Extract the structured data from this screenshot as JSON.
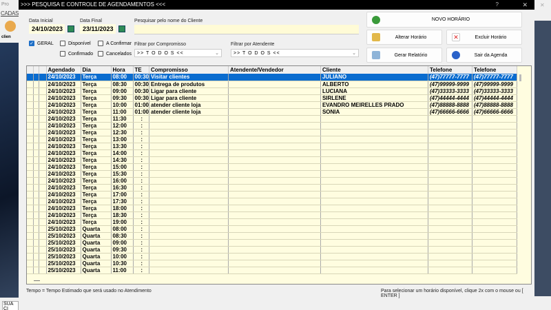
{
  "background_app": {
    "title": "Pro",
    "menu": "CADAS",
    "icon_label": "clien",
    "status": "SUA CI"
  },
  "dialog": {
    "title": ">>>  PESQUISA E CONTROLE DE AGENDAMENTOS  <<<",
    "help": "?",
    "close": "✕"
  },
  "filters": {
    "data_inicial_label": "Data Inicial",
    "data_inicial": "24/10/2023",
    "data_final_label": "Data Final",
    "data_final": "23/11/2023",
    "search_label": "Pesquisar pelo nome do Cliente",
    "search_value": "",
    "checks": [
      {
        "label": "GERAL",
        "checked": true
      },
      {
        "label": "Disponível",
        "checked": false
      },
      {
        "label": "A Confirmar",
        "checked": false
      },
      {
        "label": "Confirmado",
        "checked": false
      },
      {
        "label": "Cancelados",
        "checked": false
      }
    ],
    "compromisso_label": "Filtrar por Compromisso",
    "compromisso_value": ">> T O D O S <<",
    "atendente_label": "Filtrar por Atendente",
    "atendente_value": ">> T O D O S <<"
  },
  "buttons": {
    "novo": "NOVO HORÁRIO",
    "alterar": "Alterar Horário",
    "excluir": "Excluir Horário",
    "relatorio": "Gerar Relatório",
    "sair": "Sair da Agenda"
  },
  "colors": {
    "grid_bg": "#fffde0",
    "selected": "#0a6ccf"
  },
  "table": {
    "headers": [
      "",
      "",
      "",
      "Agendado",
      "Dia",
      "Hora",
      "TE",
      "Compromisso",
      "Atendente/Vendedor",
      "Cliente",
      "Telefone",
      "Telefone"
    ],
    "rows": [
      [
        "24/10/2023",
        "Terça",
        "08:00",
        "00:30",
        "Visitar clientes",
        "",
        "JULIANO",
        "(47)77777-7777",
        "(47)77777-7777"
      ],
      [
        "24/10/2023",
        "Terça",
        "08:30",
        "00:30",
        "Entrega de produtos",
        "",
        "ALBERTO",
        "(47)99999-9999",
        "(47)99999-9999"
      ],
      [
        "24/10/2023",
        "Terça",
        "09:00",
        "00:30",
        "Ligar para cliente",
        "",
        "LUCIANA",
        "(47)33333-3333",
        "(47)33333-3333"
      ],
      [
        "24/10/2023",
        "Terça",
        "09:30",
        "00:30",
        "Ligar para cliente",
        "",
        "SIRLENE",
        "(47)44444-4444",
        "(47)44444-4444"
      ],
      [
        "24/10/2023",
        "Terça",
        "10:00",
        "01:00",
        "atender cliente loja",
        "",
        "EVANDRO MEIRELLES PRADO",
        "(47)88888-8888",
        "(47)88888-8888"
      ],
      [
        "24/10/2023",
        "Terça",
        "11:00",
        "01:00",
        "atender cliente loja",
        "",
        "SONIA",
        "(47)66666-6666",
        "(47)66666-6666"
      ],
      [
        "24/10/2023",
        "Terça",
        "11:30",
        ":",
        "",
        "",
        "",
        "",
        ""
      ],
      [
        "24/10/2023",
        "Terça",
        "12:00",
        ":",
        "",
        "",
        "",
        "",
        ""
      ],
      [
        "24/10/2023",
        "Terça",
        "12:30",
        ":",
        "",
        "",
        "",
        "",
        ""
      ],
      [
        "24/10/2023",
        "Terça",
        "13:00",
        ":",
        "",
        "",
        "",
        "",
        ""
      ],
      [
        "24/10/2023",
        "Terça",
        "13:30",
        ":",
        "",
        "",
        "",
        "",
        ""
      ],
      [
        "24/10/2023",
        "Terça",
        "14:00",
        ":",
        "",
        "",
        "",
        "",
        ""
      ],
      [
        "24/10/2023",
        "Terça",
        "14:30",
        ":",
        "",
        "",
        "",
        "",
        ""
      ],
      [
        "24/10/2023",
        "Terça",
        "15:00",
        ":",
        "",
        "",
        "",
        "",
        ""
      ],
      [
        "24/10/2023",
        "Terça",
        "15:30",
        ":",
        "",
        "",
        "",
        "",
        ""
      ],
      [
        "24/10/2023",
        "Terça",
        "16:00",
        ":",
        "",
        "",
        "",
        "",
        ""
      ],
      [
        "24/10/2023",
        "Terça",
        "16:30",
        ":",
        "",
        "",
        "",
        "",
        ""
      ],
      [
        "24/10/2023",
        "Terça",
        "17:00",
        ":",
        "",
        "",
        "",
        "",
        ""
      ],
      [
        "24/10/2023",
        "Terça",
        "17:30",
        ":",
        "",
        "",
        "",
        "",
        ""
      ],
      [
        "24/10/2023",
        "Terça",
        "18:00",
        ":",
        "",
        "",
        "",
        "",
        ""
      ],
      [
        "24/10/2023",
        "Terça",
        "18:30",
        ":",
        "",
        "",
        "",
        "",
        ""
      ],
      [
        "24/10/2023",
        "Terça",
        "19:00",
        ":",
        "",
        "",
        "",
        "",
        ""
      ],
      [
        "25/10/2023",
        "Quarta",
        "08:00",
        ":",
        "",
        "",
        "",
        "",
        ""
      ],
      [
        "25/10/2023",
        "Quarta",
        "08:30",
        ":",
        "",
        "",
        "",
        "",
        ""
      ],
      [
        "25/10/2023",
        "Quarta",
        "09:00",
        ":",
        "",
        "",
        "",
        "",
        ""
      ],
      [
        "25/10/2023",
        "Quarta",
        "09:30",
        ":",
        "",
        "",
        "",
        "",
        ""
      ],
      [
        "25/10/2023",
        "Quarta",
        "10:00",
        ":",
        "",
        "",
        "",
        "",
        ""
      ],
      [
        "25/10/2023",
        "Quarta",
        "10:30",
        ":",
        "",
        "",
        "",
        "",
        ""
      ],
      [
        "25/10/2023",
        "Quarta",
        "11:00",
        ":",
        "",
        "",
        "",
        "",
        ""
      ]
    ],
    "selected_row": 0
  },
  "footer": {
    "left": "Tempo = Tempo Estimado que será usado no Atendimento",
    "right": "Para selecionar um horário disponível, clique 2x com o mouse ou [ ENTER ]"
  }
}
